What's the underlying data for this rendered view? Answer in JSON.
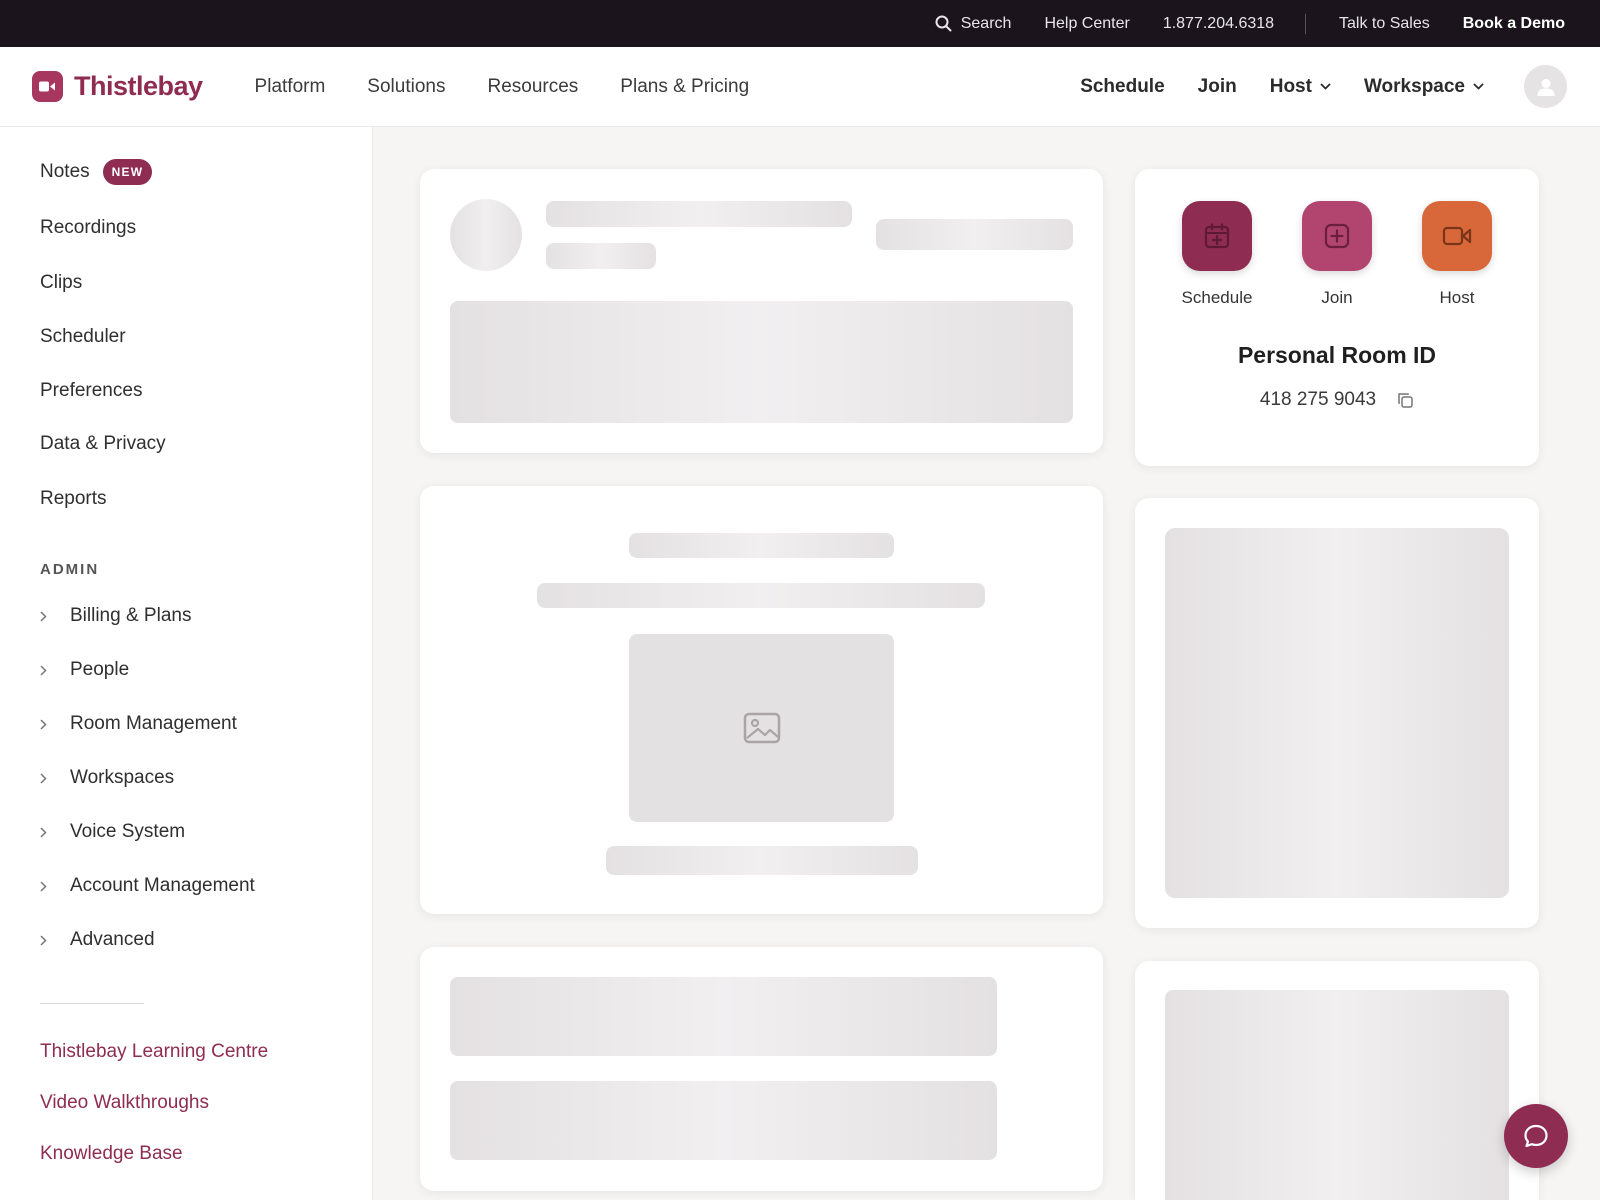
{
  "utility": {
    "search_label": "Search",
    "help_label": "Help Center",
    "phone": "1.877.204.6318",
    "sales_label": "Talk to Sales",
    "demo_label": "Book a Demo"
  },
  "brand": {
    "name": "Thistlebay",
    "color": "#8e2c52"
  },
  "nav": {
    "links": [
      "Platform",
      "Solutions",
      "Resources",
      "Plans & Pricing"
    ],
    "actions": {
      "schedule": "Schedule",
      "join": "Join",
      "host": "Host",
      "workspace": "Workspace"
    }
  },
  "sidebar": {
    "items": [
      "Notes",
      "Recordings",
      "Clips",
      "Scheduler",
      "Preferences",
      "Data & Privacy",
      "Reports"
    ],
    "new_badge": "NEW",
    "admin_header": "ADMIN",
    "admin_items": [
      "Billing & Plans",
      "People",
      "Room Management",
      "Workspaces",
      "Voice System",
      "Account Management",
      "Advanced"
    ],
    "links": [
      "Thistlebay Learning Centre",
      "Video Walkthroughs",
      "Knowledge Base"
    ]
  },
  "quick_actions": {
    "schedule": {
      "label": "Schedule",
      "color": "#8e2c52",
      "icon": "calendar-plus-icon"
    },
    "join": {
      "label": "Join",
      "color": "#b14570",
      "icon": "plus-square-icon"
    },
    "host": {
      "label": "Host",
      "color": "#d8683a",
      "icon": "video-camera-icon"
    }
  },
  "room": {
    "title": "Personal Room ID",
    "id": "418 275 9043"
  }
}
